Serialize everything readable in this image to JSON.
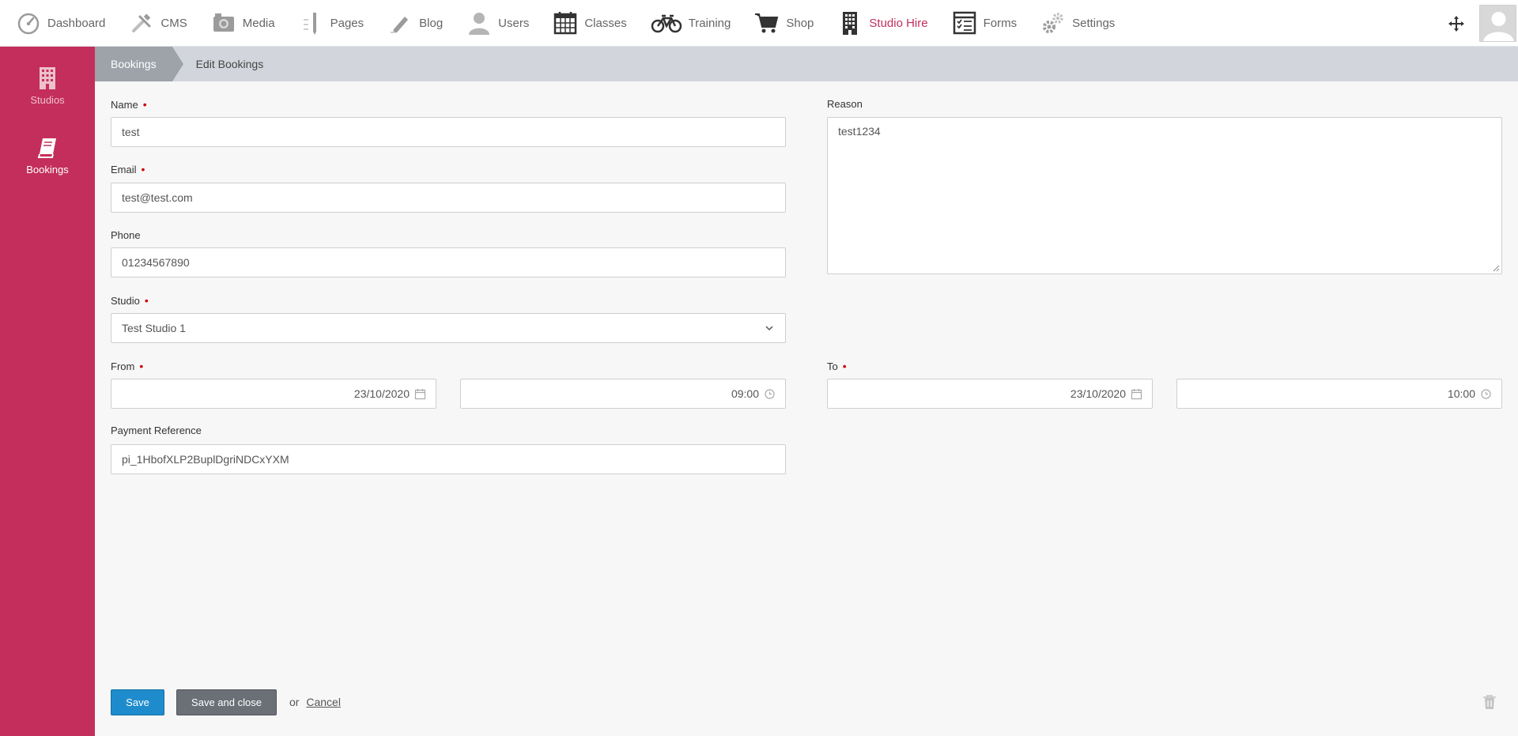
{
  "nav": {
    "items": [
      {
        "label": "Dashboard",
        "icon": "speedometer-icon"
      },
      {
        "label": "CMS",
        "icon": "tools-icon"
      },
      {
        "label": "Media",
        "icon": "camera-icon"
      },
      {
        "label": "Pages",
        "icon": "pen-icon"
      },
      {
        "label": "Blog",
        "icon": "pencil-icon"
      },
      {
        "label": "Users",
        "icon": "user-icon"
      },
      {
        "label": "Classes",
        "icon": "calendar-icon"
      },
      {
        "label": "Training",
        "icon": "bicycle-icon"
      },
      {
        "label": "Shop",
        "icon": "cart-icon"
      },
      {
        "label": "Studio Hire",
        "icon": "building-icon"
      },
      {
        "label": "Forms",
        "icon": "form-icon"
      },
      {
        "label": "Settings",
        "icon": "gears-icon"
      }
    ],
    "active": "Studio Hire"
  },
  "sidebar": {
    "items": [
      {
        "label": "Studios",
        "icon": "building-icon"
      },
      {
        "label": "Bookings",
        "icon": "book-icon"
      }
    ]
  },
  "breadcrumb": {
    "first": "Bookings",
    "second": "Edit Bookings"
  },
  "form": {
    "name": {
      "label": "Name",
      "value": "test"
    },
    "email": {
      "label": "Email",
      "value": "test@test.com"
    },
    "phone": {
      "label": "Phone",
      "value": "01234567890"
    },
    "studio": {
      "label": "Studio",
      "value": "Test Studio 1"
    },
    "from": {
      "label": "From",
      "date": "23/10/2020",
      "time": "09:00"
    },
    "to": {
      "label": "To",
      "date": "23/10/2020",
      "time": "10:00"
    },
    "payment_reference": {
      "label": "Payment Reference",
      "value": "pi_1HbofXLP2BuplDgriNDCxYXM"
    },
    "reason": {
      "label": "Reason",
      "value": "test1234"
    }
  },
  "footer": {
    "save_label": "Save",
    "save_close_label": "Save and close",
    "or_text": "or",
    "cancel_label": "Cancel"
  },
  "colors": {
    "brand": "#c42e5c",
    "primary_button": "#1e8ccc",
    "secondary_button": "#6b7077"
  }
}
